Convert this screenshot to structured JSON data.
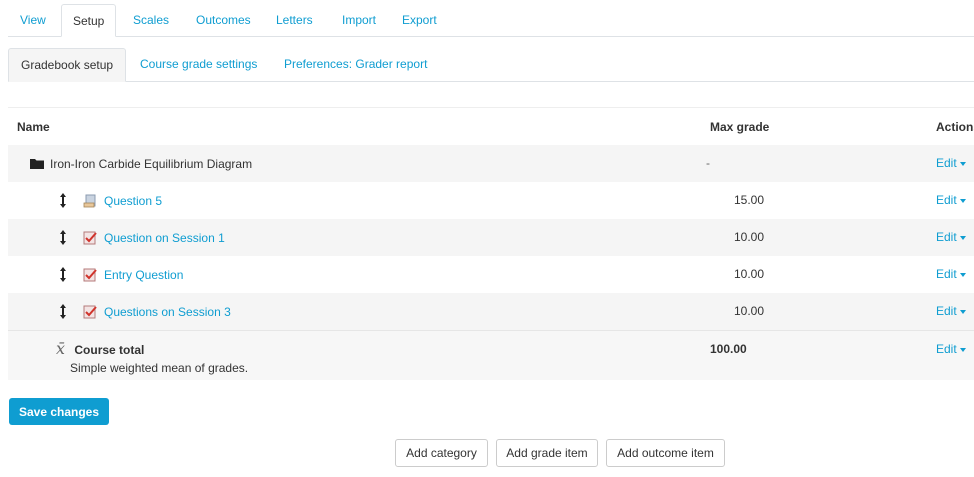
{
  "tabs": {
    "view": "View",
    "setup": "Setup",
    "scales": "Scales",
    "outcomes": "Outcomes",
    "letters": "Letters",
    "import": "Import",
    "export": "Export"
  },
  "subtabs": {
    "gradebook_setup": "Gradebook setup",
    "course_grade_settings": "Course grade settings",
    "preferences_grader_report": "Preferences: Grader report"
  },
  "table": {
    "headers": {
      "name": "Name",
      "max_grade": "Max grade",
      "actions": "Actions"
    },
    "category": {
      "name": "Iron-Iron Carbide Equilibrium Diagram",
      "max_grade": "-",
      "action": "Edit"
    },
    "items": [
      {
        "name": "Question 5",
        "max_grade": "15.00",
        "action": "Edit",
        "icon": "quiz-icon-grey"
      },
      {
        "name": "Question on Session 1",
        "max_grade": "10.00",
        "action": "Edit",
        "icon": "quiz-icon-red"
      },
      {
        "name": "Entry Question",
        "max_grade": "10.00",
        "action": "Edit",
        "icon": "quiz-icon-red"
      },
      {
        "name": "Questions on Session 3",
        "max_grade": "10.00",
        "action": "Edit",
        "icon": "quiz-icon-red"
      }
    ],
    "total": {
      "name": "Course total",
      "description": "Simple weighted mean of grades.",
      "max_grade": "100.00",
      "action": "Edit"
    }
  },
  "buttons": {
    "save_changes": "Save changes",
    "add_category": "Add category",
    "add_grade_item": "Add grade item",
    "add_outcome_item": "Add outcome item"
  },
  "colors": {
    "accent": "#0f9dd1",
    "alt_row": "#f5f5f5"
  }
}
